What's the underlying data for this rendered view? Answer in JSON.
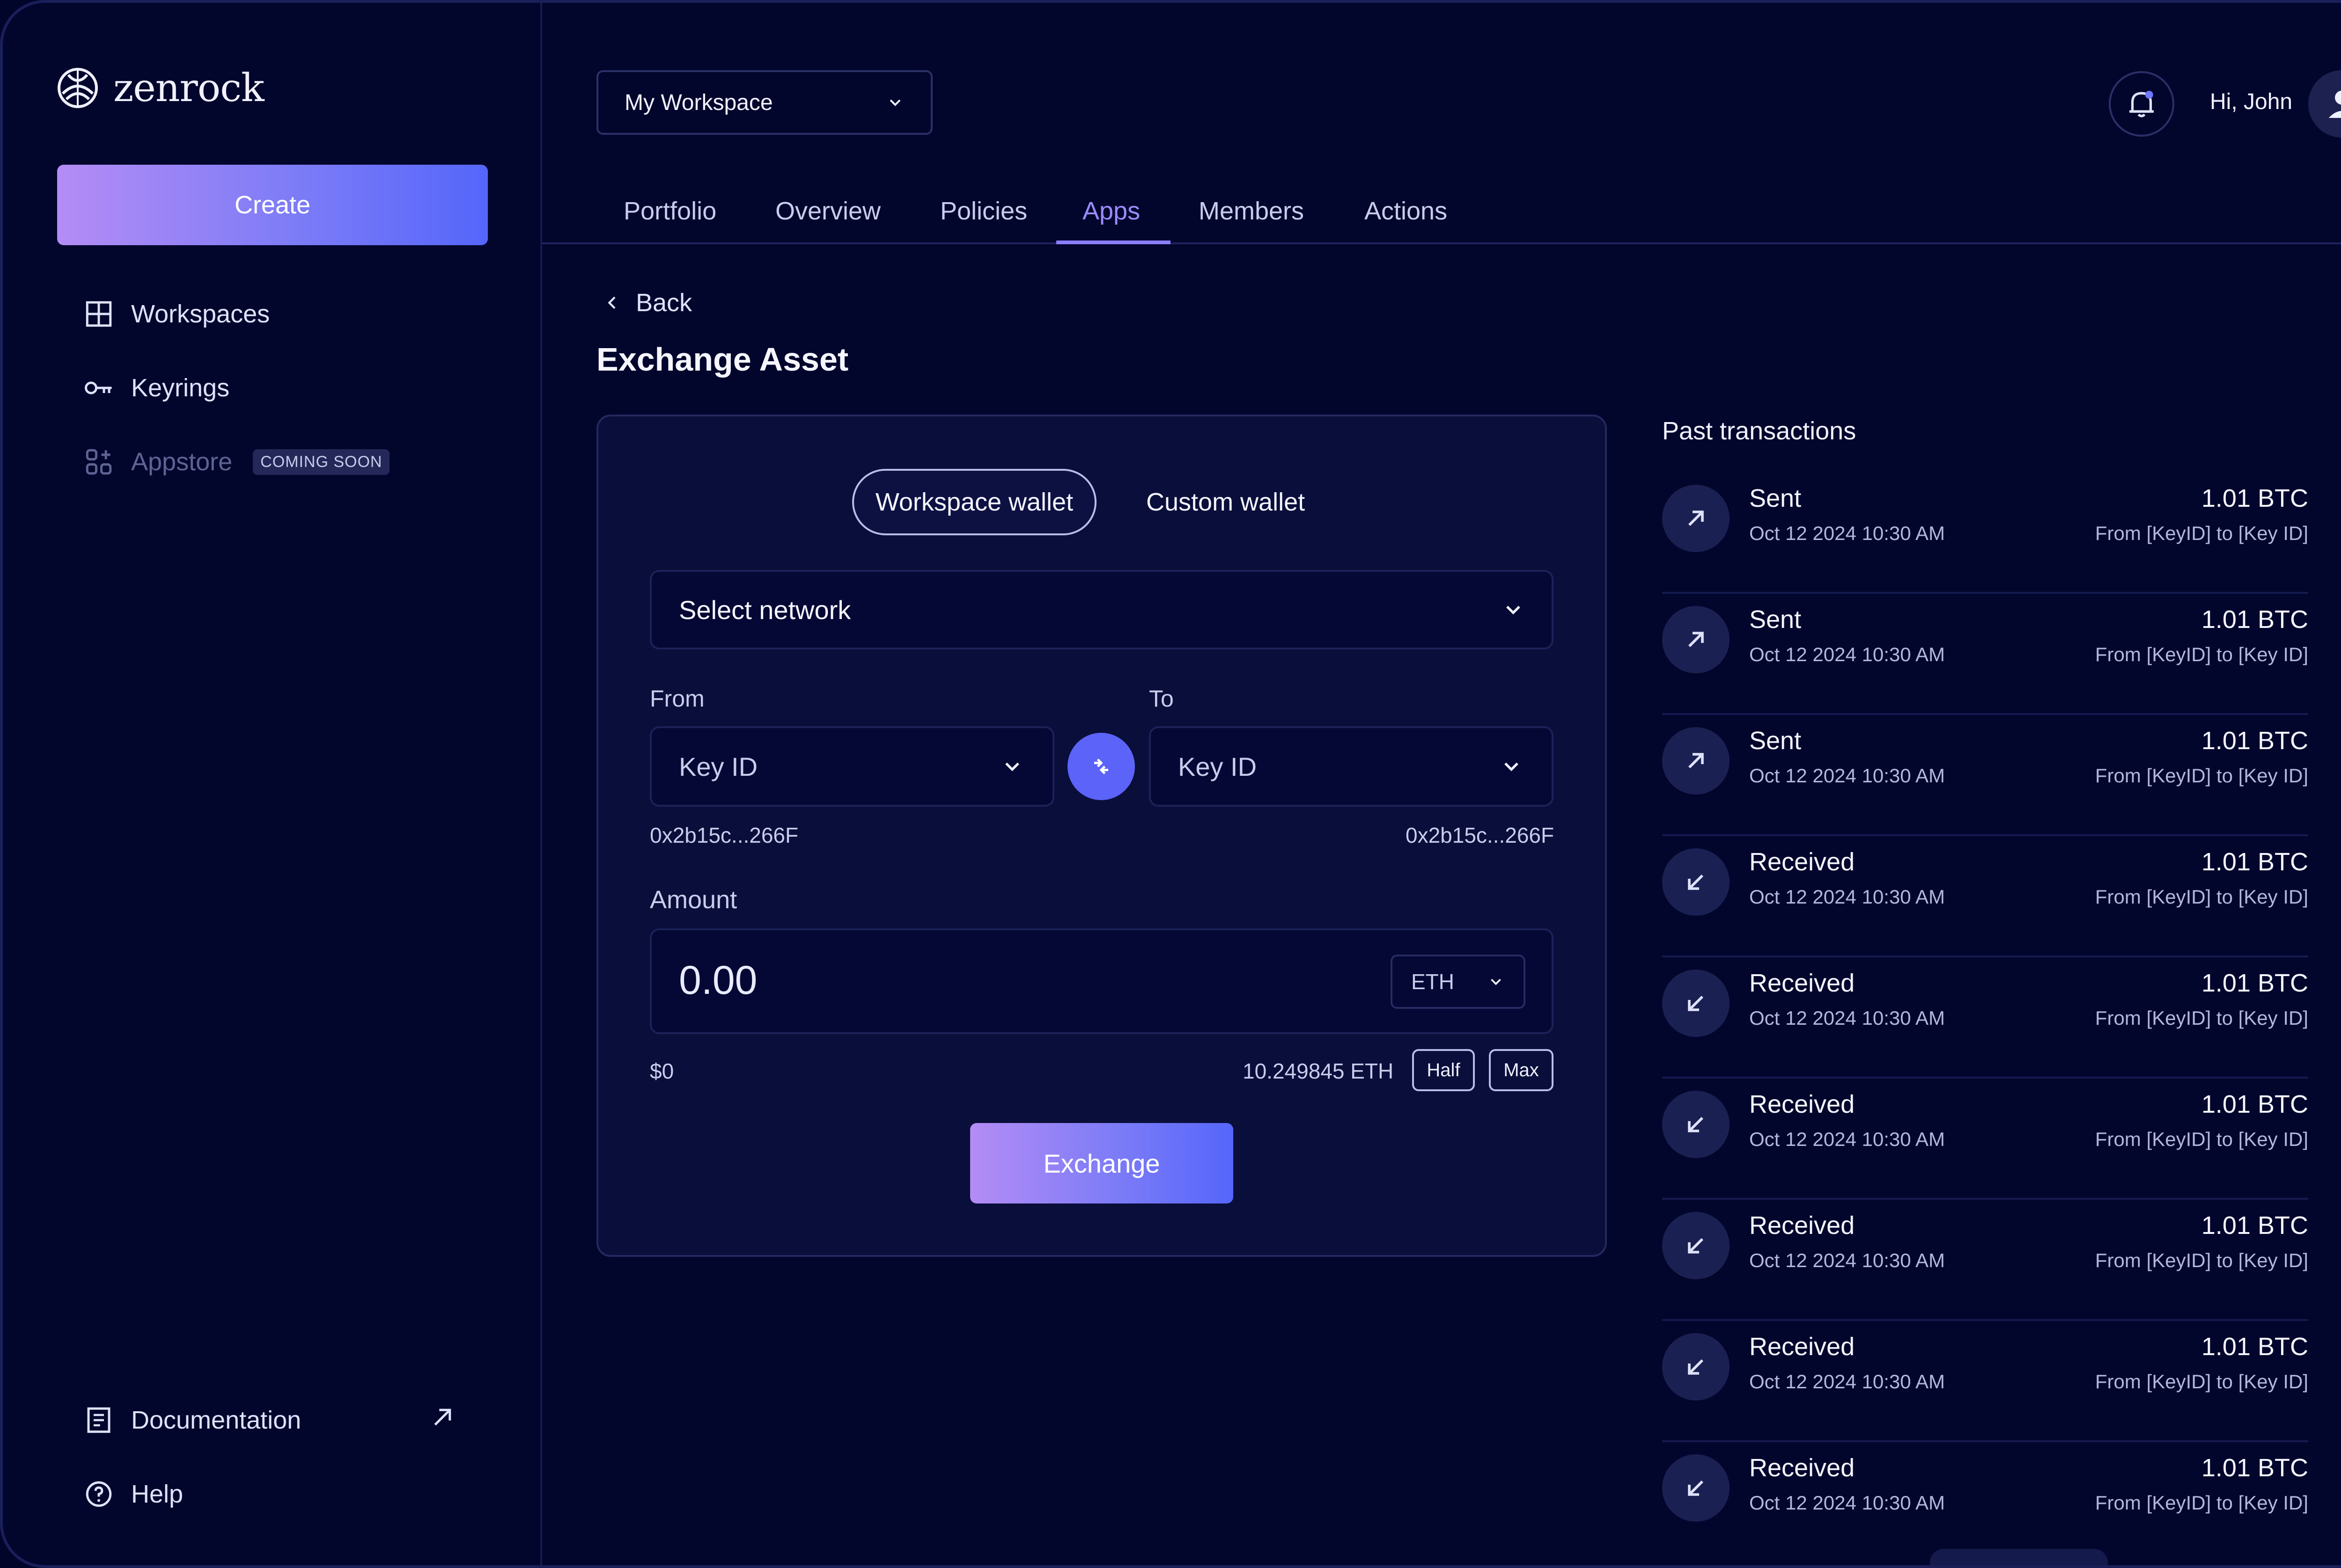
{
  "brand": {
    "name": "zenrock"
  },
  "sidebar": {
    "create_label": "Create",
    "items": [
      {
        "label": "Workspaces",
        "icon": "grid-icon"
      },
      {
        "label": "Keyrings",
        "icon": "key-icon"
      },
      {
        "label": "Appstore",
        "icon": "apps-icon",
        "badge": "COMING SOON"
      }
    ],
    "footer": [
      {
        "label": "Documentation",
        "icon": "document-icon"
      },
      {
        "label": "Help",
        "icon": "help-icon"
      }
    ]
  },
  "header": {
    "workspace": "My Workspace",
    "greeting": "Hi, John",
    "tabs": [
      "Portfolio",
      "Overview",
      "Policies",
      "Apps",
      "Members",
      "Actions"
    ],
    "active_tab": "Apps"
  },
  "page": {
    "back_label": "Back",
    "title": "Exchange Asset"
  },
  "exchange": {
    "wallet_options": [
      "Workspace wallet",
      "Custom wallet"
    ],
    "network_placeholder": "Select network",
    "from_label": "From",
    "to_label": "To",
    "from_key": "Key ID",
    "to_key": "Key ID",
    "from_address": "0x2b15c...266F",
    "to_address": "0x2b15c...266F",
    "amount_label": "Amount",
    "amount_value": "0.00",
    "currency": "ETH",
    "usd_value": "$0",
    "balance": "10.249845 ETH",
    "half_label": "Half",
    "max_label": "Max",
    "submit_label": "Exchange"
  },
  "transactions": {
    "title": "Past transactions",
    "items": [
      {
        "type": "Sent",
        "date": "Oct 12 2024 10:30 AM",
        "amount": "1.01 BTC",
        "route": "From [KeyID] to [Key ID]",
        "icon": "arrow-up-right-icon"
      },
      {
        "type": "Sent",
        "date": "Oct 12 2024 10:30 AM",
        "amount": "1.01 BTC",
        "route": "From [KeyID] to [Key ID]",
        "icon": "arrow-up-right-icon"
      },
      {
        "type": "Sent",
        "date": "Oct 12 2024 10:30 AM",
        "amount": "1.01 BTC",
        "route": "From [KeyID] to [Key ID]",
        "icon": "arrow-up-right-icon"
      },
      {
        "type": "Received",
        "date": "Oct 12 2024 10:30 AM",
        "amount": "1.01 BTC",
        "route": "From [KeyID] to [Key ID]",
        "icon": "arrow-down-left-icon"
      },
      {
        "type": "Received",
        "date": "Oct 12 2024 10:30 AM",
        "amount": "1.01 BTC",
        "route": "From [KeyID] to [Key ID]",
        "icon": "arrow-down-left-icon"
      },
      {
        "type": "Received",
        "date": "Oct 12 2024 10:30 AM",
        "amount": "1.01 BTC",
        "route": "From [KeyID] to [Key ID]",
        "icon": "arrow-down-left-icon"
      },
      {
        "type": "Received",
        "date": "Oct 12 2024 10:30 AM",
        "amount": "1.01 BTC",
        "route": "From [KeyID] to [Key ID]",
        "icon": "arrow-down-left-icon"
      },
      {
        "type": "Received",
        "date": "Oct 12 2024 10:30 AM",
        "amount": "1.01 BTC",
        "route": "From [KeyID] to [Key ID]",
        "icon": "arrow-down-left-icon"
      },
      {
        "type": "Received",
        "date": "Oct 12 2024 10:30 AM",
        "amount": "1.01 BTC",
        "route": "From [KeyID] to [Key ID]",
        "icon": "arrow-down-left-icon"
      }
    ]
  },
  "colors": {
    "background": "#03062c",
    "accent": "#5b63f8",
    "active_tab": "#9a8cff",
    "gradient_start": "#b48cf5",
    "gradient_end": "#5566fb"
  }
}
